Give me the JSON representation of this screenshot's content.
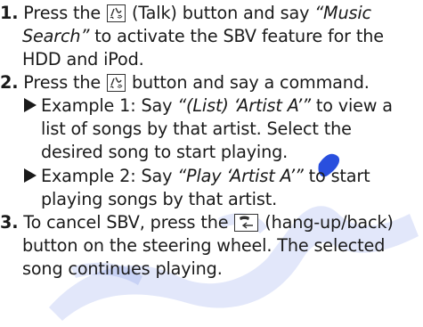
{
  "step1": {
    "number": "1.",
    "line1_pre": "Press the",
    "line1_mid": "(Talk) button and say",
    "line1_quote": "“Music",
    "line2_quote": "Search”",
    "line2_post": "to activate the SBV feature for the",
    "line3": "HDD and iPod."
  },
  "step2": {
    "number": "2.",
    "line1_pre": "Press the",
    "line1_post": "button and say a command.",
    "ex1_pre": "Example 1: Say",
    "ex1_quote": "“(List) ‘Artist A’”",
    "ex1_post": "to view a",
    "ex1_line2": "list of songs by that artist. Select the",
    "ex1_line3": "desired song to start playing.",
    "ex2_pre": "Example 2: Say",
    "ex2_quote": "“Play ‘Artist A’”",
    "ex2_post": "to start",
    "ex2_line2": "playing songs by that artist."
  },
  "step3": {
    "number": "3.",
    "line1_pre": "To cancel SBV, press the",
    "line1_post": "(hang-up/back)",
    "line2": "button on the steering wheel. The selected",
    "line3": "song continues playing."
  },
  "icons": {
    "talk": "talk-button-icon",
    "hangup": "hang-up-back-button-icon",
    "bullet": "triangle-bullet-icon"
  },
  "colors": {
    "text": "#1a1a1a",
    "watermark": "#1e46dc"
  }
}
